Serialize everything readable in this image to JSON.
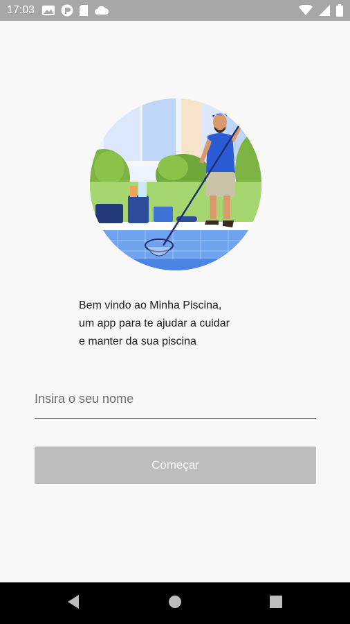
{
  "status_bar": {
    "time": "17:03",
    "left_icons": [
      "gallery-icon",
      "app-badge-icon",
      "sd-card-icon",
      "cloud-icon"
    ],
    "right_icons": [
      "wifi-icon",
      "signal-icon",
      "battery-icon"
    ]
  },
  "welcome": {
    "line1": "Bem vindo ao Minha Piscina,",
    "line2": "um app para te ajudar a cuidar",
    "line3": "e manter da sua piscina"
  },
  "name_input": {
    "placeholder": "Insira o seu nome",
    "value": ""
  },
  "start_button": {
    "label": "Começar"
  },
  "nav_bar": {
    "icons": [
      "back-icon",
      "home-icon",
      "recents-icon"
    ]
  },
  "colors": {
    "status_bar": "#a7a7a7",
    "background": "#f8f8f8",
    "button_disabled": "#bdbdbd",
    "nav_bar": "#000000"
  }
}
